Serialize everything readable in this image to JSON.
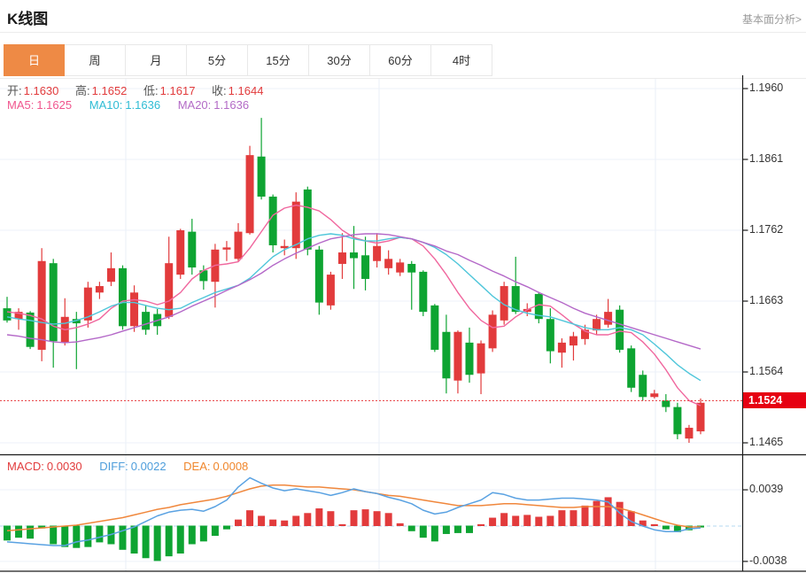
{
  "header": {
    "title": "K线图",
    "link": "基本面分析>"
  },
  "tabs": {
    "items": [
      "日",
      "周",
      "月",
      "5分",
      "15分",
      "30分",
      "60分",
      "4时"
    ],
    "active": "日"
  },
  "ohlc": {
    "open_label": "开:",
    "open": "1.1630",
    "high_label": "高:",
    "high": "1.1652",
    "low_label": "低:",
    "low": "1.1617",
    "close_label": "收:",
    "close": "1.1644"
  },
  "ma_legend": {
    "ma5_label": "MA5:",
    "ma5": "1.1625",
    "ma10_label": "MA10:",
    "ma10": "1.1636",
    "ma20_label": "MA20:",
    "ma20": "1.1636"
  },
  "price_axis": {
    "labels": [
      "1.1960",
      "1.1861",
      "1.1762",
      "1.1663",
      "1.1564",
      "1.1465"
    ],
    "current_price": "1.1524"
  },
  "macd_header": {
    "macd_label": "MACD:",
    "macd": "0.0030",
    "diff_label": "DIFF:",
    "diff": "0.0022",
    "dea_label": "DEA:",
    "dea": "0.0008"
  },
  "macd_axis": {
    "top": "0.0039",
    "bottom": "-0.0038"
  },
  "colors": {
    "up": "#e23b3c",
    "down": "#0ea432",
    "ma5": "#f0679e",
    "ma10": "#4fc6da",
    "ma20": "#b468c8",
    "diff": "#5aa2e2",
    "dea": "#f0873c",
    "accent_tab": "#ee8a45",
    "price_tag_bg": "#e60012",
    "dotted_line": "#e8393c",
    "zero_line": "#b5d8f2",
    "grid": "#edf2f9",
    "vgrid": "#e9eff7",
    "axis": "#1a1a1a"
  },
  "chart_data": {
    "type": "candlestick+macd",
    "title": "K线图",
    "legend": [
      "MA5",
      "MA10",
      "MA20"
    ],
    "price_ylim": [
      1.1465,
      1.196
    ],
    "current_price": 1.1524,
    "grid": true,
    "candles": [
      [
        1.1653,
        1.1669,
        1.1633,
        1.1636
      ],
      [
        1.1638,
        1.1653,
        1.1623,
        1.1648
      ],
      [
        1.1647,
        1.1649,
        1.1596,
        1.1599
      ],
      [
        1.1595,
        1.1737,
        1.1579,
        1.1719
      ],
      [
        1.1716,
        1.1722,
        1.157,
        1.1607
      ],
      [
        1.1605,
        1.1667,
        1.1601,
        1.1641
      ],
      [
        1.1638,
        1.1648,
        1.1568,
        1.1632
      ],
      [
        1.1636,
        1.169,
        1.1626,
        1.1682
      ],
      [
        1.1675,
        1.169,
        1.1666,
        1.1684
      ],
      [
        1.169,
        1.1731,
        1.1684,
        1.1709
      ],
      [
        1.1709,
        1.1713,
        1.1623,
        1.1628
      ],
      [
        1.1628,
        1.1685,
        1.162,
        1.1675
      ],
      [
        1.1648,
        1.1657,
        1.1616,
        1.1623
      ],
      [
        1.1645,
        1.1652,
        1.1616,
        1.1628
      ],
      [
        1.1641,
        1.1753,
        1.1638,
        1.1716
      ],
      [
        1.17,
        1.1764,
        1.1694,
        1.1762
      ],
      [
        1.176,
        1.1778,
        1.17,
        1.171
      ],
      [
        1.1706,
        1.1713,
        1.1679,
        1.1691
      ],
      [
        1.169,
        1.1743,
        1.1654,
        1.1735
      ],
      [
        1.1735,
        1.1747,
        1.1719,
        1.1738
      ],
      [
        1.1722,
        1.1772,
        1.1719,
        1.176
      ],
      [
        1.1758,
        1.188,
        1.1756,
        1.1867
      ],
      [
        1.1865,
        1.1919,
        1.1805,
        1.1809
      ],
      [
        1.1809,
        1.1812,
        1.1731,
        1.1741
      ],
      [
        1.1737,
        1.1749,
        1.1727,
        1.174
      ],
      [
        1.1737,
        1.1815,
        1.1722,
        1.1802
      ],
      [
        1.1819,
        1.1823,
        1.1727,
        1.1735
      ],
      [
        1.1735,
        1.174,
        1.1644,
        1.1661
      ],
      [
        1.1657,
        1.1704,
        1.1651,
        1.17
      ],
      [
        1.1715,
        1.1758,
        1.1694,
        1.1731
      ],
      [
        1.1731,
        1.1768,
        1.168,
        1.1723
      ],
      [
        1.1727,
        1.1753,
        1.1678,
        1.1694
      ],
      [
        1.1719,
        1.1758,
        1.171,
        1.174
      ],
      [
        1.1709,
        1.1734,
        1.17,
        1.1722
      ],
      [
        1.1703,
        1.1722,
        1.1698,
        1.1717
      ],
      [
        1.1715,
        1.1719,
        1.1651,
        1.1703
      ],
      [
        1.1704,
        1.1706,
        1.1642,
        1.1648
      ],
      [
        1.1657,
        1.1659,
        1.1592,
        1.1595
      ],
      [
        1.162,
        1.1644,
        1.1534,
        1.1555
      ],
      [
        1.1552,
        1.1622,
        1.1534,
        1.162
      ],
      [
        1.1605,
        1.1626,
        1.1549,
        1.156
      ],
      [
        1.1562,
        1.1608,
        1.1533,
        1.1604
      ],
      [
        1.1597,
        1.165,
        1.1592,
        1.1644
      ],
      [
        1.1636,
        1.169,
        1.163,
        1.1684
      ],
      [
        1.1684,
        1.1725,
        1.1645,
        1.1648
      ],
      [
        1.1648,
        1.166,
        1.1642,
        1.1652
      ],
      [
        1.1673,
        1.1676,
        1.1632,
        1.1638
      ],
      [
        1.1638,
        1.1653,
        1.1576,
        1.1593
      ],
      [
        1.1591,
        1.1611,
        1.157,
        1.1605
      ],
      [
        1.1601,
        1.162,
        1.158,
        1.1614
      ],
      [
        1.161,
        1.163,
        1.1602,
        1.1623
      ],
      [
        1.1622,
        1.1644,
        1.1616,
        1.1638
      ],
      [
        1.163,
        1.1666,
        1.1626,
        1.1648
      ],
      [
        1.1651,
        1.1657,
        1.1591,
        1.1595
      ],
      [
        1.1597,
        1.1601,
        1.1536,
        1.1542
      ],
      [
        1.156,
        1.1566,
        1.1524,
        1.1529
      ],
      [
        1.1529,
        1.1539,
        1.1527,
        1.1534
      ],
      [
        1.1524,
        1.1533,
        1.1508,
        1.1515
      ],
      [
        1.1515,
        1.1521,
        1.147,
        1.1477
      ],
      [
        1.1471,
        1.149,
        1.1465,
        1.1486
      ],
      [
        1.1481,
        1.1527,
        1.1477,
        1.1521
      ]
    ],
    "ma5": [
      1.1648,
      1.1646,
      1.1643,
      1.1638,
      1.1628,
      1.1623,
      1.1626,
      1.1631,
      1.1638,
      1.1653,
      1.1663,
      1.1665,
      1.1663,
      1.1658,
      1.1663,
      1.1675,
      1.1694,
      1.1706,
      1.1713,
      1.1715,
      1.1718,
      1.1737,
      1.176,
      1.1783,
      1.1793,
      1.1797,
      1.1794,
      1.1789,
      1.1777,
      1.1762,
      1.1752,
      1.1747,
      1.1744,
      1.1747,
      1.1752,
      1.175,
      1.174,
      1.1722,
      1.17,
      1.1675,
      1.1653,
      1.1636,
      1.1626,
      1.1628,
      1.1641,
      1.1651,
      1.1658,
      1.1656,
      1.1644,
      1.1631,
      1.1621,
      1.1616,
      1.1616,
      1.1621,
      1.1619,
      1.1606,
      1.1589,
      1.1567,
      1.1542,
      1.1524,
      1.1517
    ],
    "ma10": [
      1.1641,
      1.1638,
      1.1636,
      1.1633,
      1.1631,
      1.1632,
      1.1636,
      1.1641,
      1.1648,
      1.1656,
      1.1661,
      1.1661,
      1.1657,
      1.1653,
      1.1651,
      1.1653,
      1.1661,
      1.1668,
      1.1675,
      1.168,
      1.1685,
      1.1695,
      1.171,
      1.1725,
      1.1735,
      1.1742,
      1.175,
      1.1755,
      1.1757,
      1.1755,
      1.175,
      1.1747,
      1.1747,
      1.175,
      1.1752,
      1.175,
      1.1745,
      1.1738,
      1.1728,
      1.1715,
      1.17,
      1.1685,
      1.167,
      1.1658,
      1.1651,
      1.1646,
      1.1643,
      1.1641,
      1.1636,
      1.1631,
      1.1626,
      1.1623,
      1.1623,
      1.1626,
      1.1623,
      1.1616,
      1.1603,
      1.1589,
      1.1574,
      1.1562,
      1.1552
    ],
    "ma20": [
      1.1616,
      1.1614,
      1.1611,
      1.1609,
      1.1606,
      1.1605,
      1.1606,
      1.1609,
      1.1612,
      1.1616,
      1.1621,
      1.1626,
      1.1631,
      1.1636,
      1.1641,
      1.1648,
      1.1656,
      1.1663,
      1.167,
      1.1678,
      1.1685,
      1.1693,
      1.1702,
      1.1713,
      1.1722,
      1.173,
      1.1737,
      1.1744,
      1.175,
      1.1753,
      1.1756,
      1.1757,
      1.1757,
      1.1756,
      1.1753,
      1.175,
      1.1745,
      1.174,
      1.1733,
      1.1728,
      1.172,
      1.1713,
      1.1705,
      1.1698,
      1.169,
      1.1683,
      1.1675,
      1.1668,
      1.1661,
      1.1653,
      1.1646,
      1.1641,
      1.1636,
      1.1631,
      1.1626,
      1.1621,
      1.1616,
      1.1611,
      1.1606,
      1.1601,
      1.1596
    ],
    "macd": {
      "ylim": [
        -0.0038,
        0.0039
      ],
      "histogram": [
        -0.0016,
        -0.0013,
        -0.0014,
        -0.0003,
        -0.002,
        -0.0023,
        -0.0024,
        -0.0023,
        -0.0018,
        -0.002,
        -0.0026,
        -0.003,
        -0.0035,
        -0.0038,
        -0.0033,
        -0.003,
        -0.002,
        -0.0017,
        -0.0011,
        -0.0004,
        0.0007,
        0.0017,
        0.0011,
        0.0007,
        0.0006,
        0.0011,
        0.0014,
        0.0019,
        0.0016,
        0.0002,
        0.0017,
        0.0018,
        0.0016,
        0.0014,
        0.0003,
        -0.0006,
        -0.0013,
        -0.0017,
        -0.0009,
        -0.0008,
        -0.0008,
        0.0002,
        0.0009,
        0.0014,
        0.0011,
        0.0012,
        0.001,
        0.0011,
        0.0017,
        0.0017,
        0.0022,
        0.0027,
        0.0031,
        0.0026,
        0.0016,
        0.0006,
        0.0002,
        -0.0004,
        -0.0007,
        -0.0005,
        -0.0002
      ],
      "diff": [
        -0.0017,
        -0.0018,
        -0.0019,
        -0.002,
        -0.0021,
        -0.0021,
        -0.0017,
        -0.0015,
        -0.0012,
        -0.0009,
        -0.0005,
        -0.0001,
        0.0005,
        0.0011,
        0.0015,
        0.0017,
        0.0018,
        0.0016,
        0.0021,
        0.0028,
        0.0042,
        0.0052,
        0.0046,
        0.0041,
        0.0038,
        0.004,
        0.0038,
        0.0036,
        0.0033,
        0.0036,
        0.004,
        0.0037,
        0.0035,
        0.0031,
        0.0028,
        0.0024,
        0.0017,
        0.0013,
        0.0015,
        0.002,
        0.0024,
        0.0028,
        0.0036,
        0.0034,
        0.003,
        0.0028,
        0.0028,
        0.0029,
        0.003,
        0.003,
        0.0029,
        0.0028,
        0.0026,
        0.0014,
        0.0005,
        0.0,
        -0.0004,
        -0.0006,
        -0.0006,
        -0.0003,
        -0.0002
      ],
      "dea": [
        -0.0005,
        -0.0004,
        -0.0003,
        -0.0002,
        -0.0001,
        0.0,
        0.0001,
        0.0003,
        0.0005,
        0.0007,
        0.0009,
        0.0012,
        0.0015,
        0.0018,
        0.002,
        0.0023,
        0.0025,
        0.0027,
        0.0029,
        0.0032,
        0.0036,
        0.004,
        0.0043,
        0.0044,
        0.0044,
        0.0043,
        0.0042,
        0.0042,
        0.0041,
        0.004,
        0.0039,
        0.0037,
        0.0035,
        0.0033,
        0.0032,
        0.003,
        0.0028,
        0.0026,
        0.0024,
        0.0022,
        0.0022,
        0.0022,
        0.0023,
        0.0024,
        0.0024,
        0.0023,
        0.0022,
        0.0021,
        0.002,
        0.002,
        0.0021,
        0.0021,
        0.0021,
        0.0019,
        0.0016,
        0.0012,
        0.0008,
        0.0004,
        0.0001,
        -0.0001,
        -0.0001
      ]
    }
  }
}
